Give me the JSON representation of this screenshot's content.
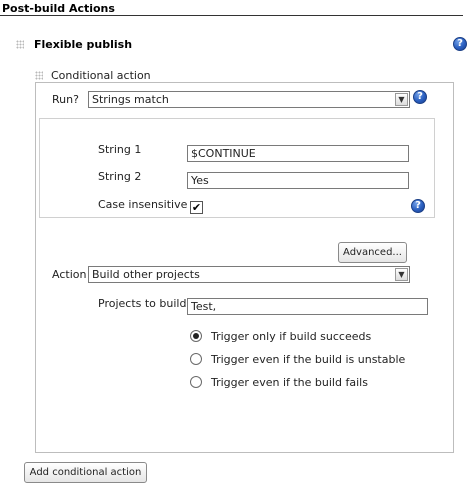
{
  "section": {
    "title": "Post-build Actions"
  },
  "flexible_publish": {
    "title": "Flexible publish",
    "help_icon": "help-icon"
  },
  "conditional_action": {
    "legend": "Conditional action",
    "run": {
      "label": "Run?",
      "selected": "Strings match"
    },
    "string1": {
      "label": "String 1",
      "value": "$CONTINUE"
    },
    "string2": {
      "label": "String 2",
      "value": "Yes"
    },
    "case_insensitive": {
      "label": "Case insensitive",
      "checked": true
    },
    "advanced_button": "Advanced...",
    "action": {
      "label": "Action",
      "selected": "Build other projects"
    },
    "projects": {
      "label": "Projects to build",
      "value": "Test,"
    },
    "radios": [
      {
        "label": "Trigger only if build succeeds",
        "checked": true
      },
      {
        "label": "Trigger even if the build is unstable",
        "checked": false
      },
      {
        "label": "Trigger even if the build fails",
        "checked": false
      }
    ]
  },
  "add_button": "Add conditional action",
  "help_glyph": "?",
  "select_arrow_glyph": "▼",
  "check_glyph": "✔"
}
